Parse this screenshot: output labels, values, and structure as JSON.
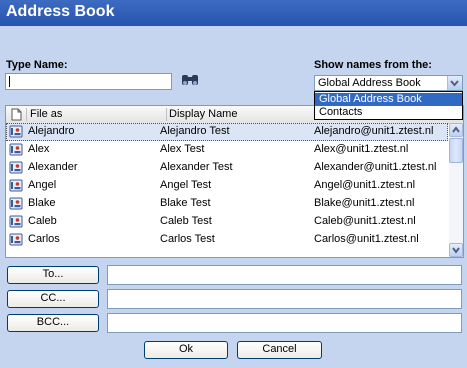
{
  "window": {
    "title": "Address Book"
  },
  "type_name": {
    "label": "Type Name:",
    "value": ""
  },
  "show_from": {
    "label": "Show names from the:",
    "selected": "Global Address Book",
    "options": [
      "Global Address Book",
      "Contacts"
    ]
  },
  "columns": {
    "file_as": "File as",
    "display_name": "Display Name"
  },
  "contacts": [
    {
      "file_as": "Alejandro",
      "display_name": "Alejandro Test",
      "email": "Alejandro@unit1.ztest.nl"
    },
    {
      "file_as": "Alex",
      "display_name": "Alex Test",
      "email": "Alex@unit1.ztest.nl"
    },
    {
      "file_as": "Alexander",
      "display_name": "Alexander Test",
      "email": "Alexander@unit1.ztest.nl"
    },
    {
      "file_as": "Angel",
      "display_name": "Angel Test",
      "email": "Angel@unit1.ztest.nl"
    },
    {
      "file_as": "Blake",
      "display_name": "Blake Test",
      "email": "Blake@unit1.ztest.nl"
    },
    {
      "file_as": "Caleb",
      "display_name": "Caleb Test",
      "email": "Caleb@unit1.ztest.nl"
    },
    {
      "file_as": "Carlos",
      "display_name": "Carlos Test",
      "email": "Carlos@unit1.ztest.nl"
    }
  ],
  "recipients": {
    "to_label": "To...",
    "cc_label": "CC...",
    "bcc_label": "BCC...",
    "to_value": "",
    "cc_value": "",
    "bcc_value": ""
  },
  "footer": {
    "ok_label": "Ok",
    "cancel_label": "Cancel"
  },
  "colors": {
    "title_bar": "#2f5fbb",
    "background": "#c5d5f0",
    "selection": "#316ac5"
  }
}
